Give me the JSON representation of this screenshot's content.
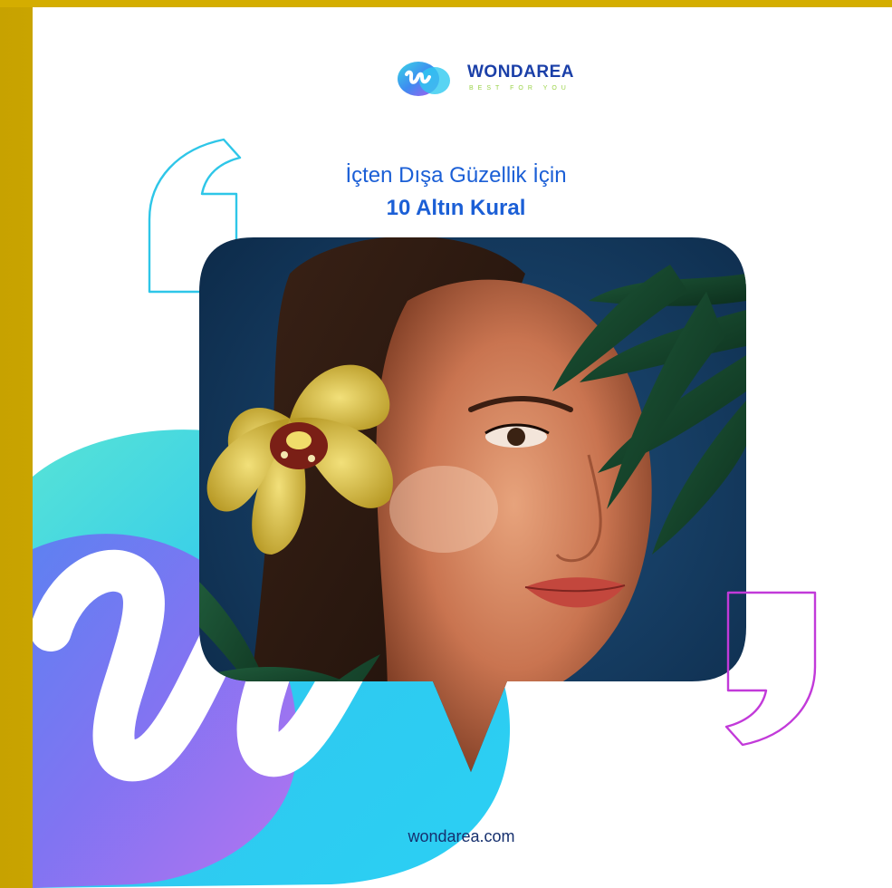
{
  "brand": {
    "name": "WONDAREA",
    "tagline": "BEST FOR YOU",
    "logo_letter": "w"
  },
  "headline": {
    "line1": "İçten Dışa Güzellik İçin",
    "line2": "10 Altın Kural"
  },
  "footer": {
    "url": "wondarea.com"
  },
  "colors": {
    "frame": "#c9a400",
    "headline": "#1b5fd6",
    "brand_text": "#1a3fa8",
    "quote_open": "#2ec6e8",
    "quote_close": "#c23ad9",
    "blob_cyan": "#2fd2f0",
    "blob_violet": "#b56cf5",
    "photo_bg": "#123a62"
  },
  "icons": {
    "logo": "wondarea-w-logo-icon",
    "open_quote": "open-quote-icon",
    "close_quote": "close-quote-icon",
    "photo": "woman-with-orchid-photo"
  }
}
